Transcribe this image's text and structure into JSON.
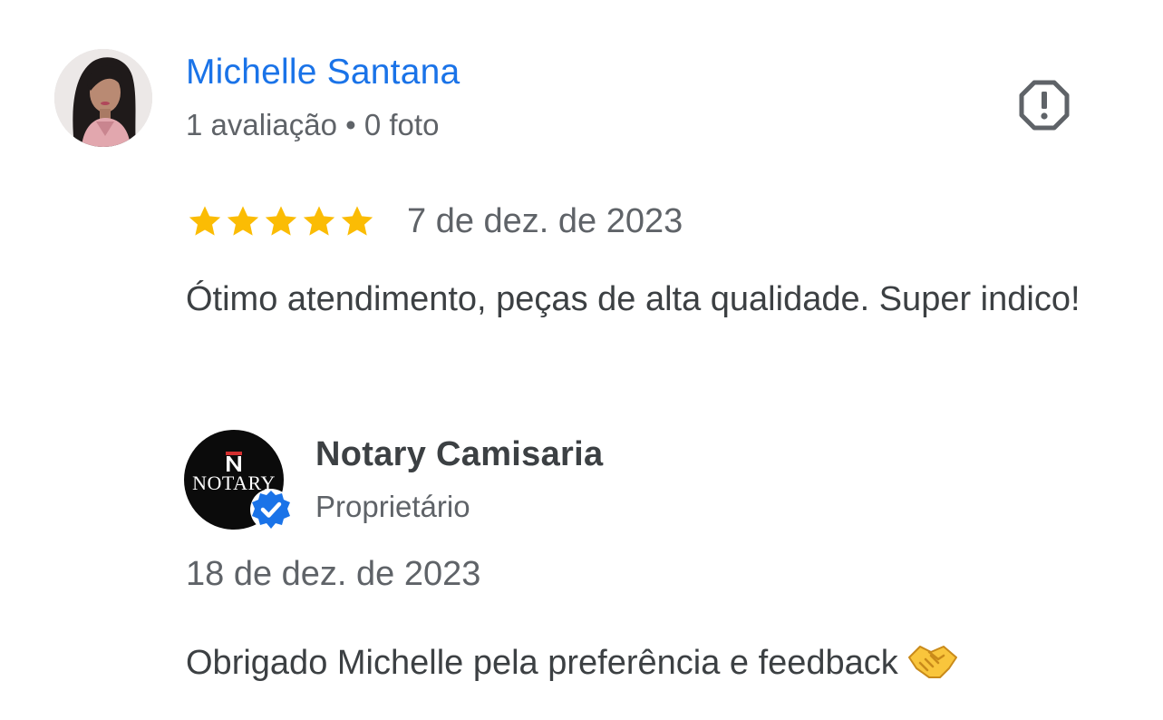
{
  "review": {
    "reviewer": {
      "name": "Michelle Santana",
      "review_count": "1 avaliação",
      "separator": "•",
      "photo_count": "0 foto",
      "avatar_icon": "profile-photo"
    },
    "report_icon": "report-flag-icon",
    "rating": {
      "stars": 5,
      "max": 5,
      "color": "#fbbc04"
    },
    "date": "7 de dez. de 2023",
    "text": "Ótimo atendimento, peças de alta qualidade. Super indico!"
  },
  "reply": {
    "owner": {
      "name": "Notary Camisaria",
      "role": "Proprietário",
      "logo_mark": "N",
      "logo_text": "NOTARY",
      "verified": true,
      "verified_color": "#1a73e8"
    },
    "date": "18 de dez. de 2023",
    "text": "Obrigado Michelle pela preferência e feedback",
    "emoji": "handshake"
  },
  "colors": {
    "link_blue": "#1a73e8",
    "secondary_text": "#5f6368",
    "primary_text": "#3c4043",
    "star_yellow": "#fbbc04"
  }
}
